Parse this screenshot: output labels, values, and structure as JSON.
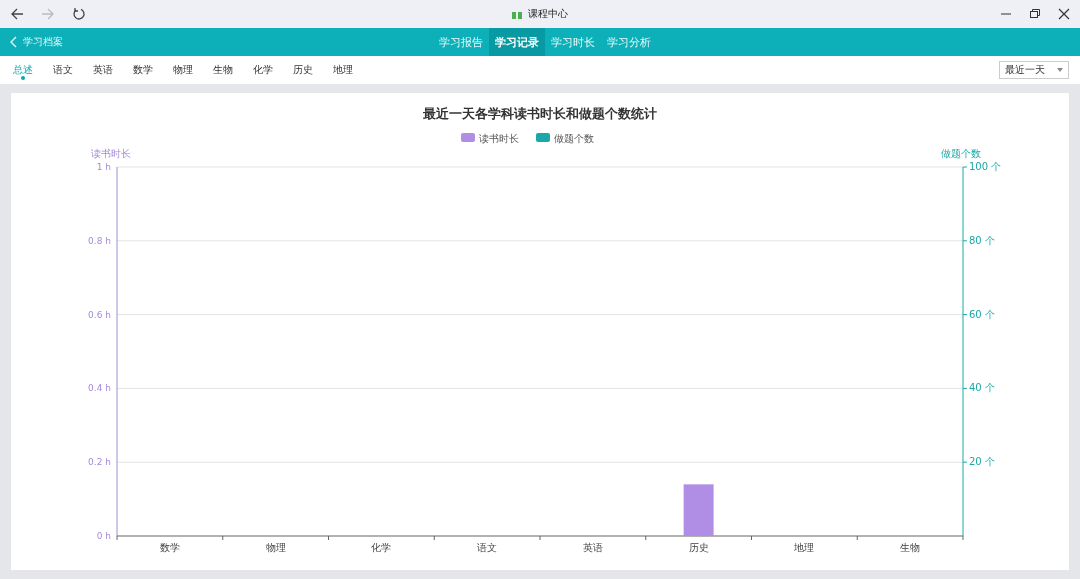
{
  "window": {
    "title": "课程中心"
  },
  "header": {
    "back_label": "学习档案",
    "tabs": [
      {
        "label": "学习报告",
        "selected": false
      },
      {
        "label": "学习记录",
        "selected": true
      },
      {
        "label": "学习时长",
        "selected": false
      },
      {
        "label": "学习分析",
        "selected": false
      }
    ]
  },
  "subjects": [
    {
      "label": "总述",
      "selected": true
    },
    {
      "label": "语文",
      "selected": false
    },
    {
      "label": "英语",
      "selected": false
    },
    {
      "label": "数学",
      "selected": false
    },
    {
      "label": "物理",
      "selected": false
    },
    {
      "label": "生物",
      "selected": false
    },
    {
      "label": "化学",
      "selected": false
    },
    {
      "label": "历史",
      "selected": false
    },
    {
      "label": "地理",
      "selected": false
    }
  ],
  "range_select": {
    "value": "最近一天"
  },
  "chart": {
    "chart_data": {
      "type": "bar",
      "title": "最近一天各学科读书时长和做题个数统计",
      "ylabel": "读书时长",
      "grid": true,
      "categories": [
        "数学",
        "物理",
        "化学",
        "语文",
        "英语",
        "历史",
        "地理",
        "生物"
      ],
      "series": [
        {
          "name": "读书时长",
          "color": "#b08ee6",
          "values": [
            0,
            0,
            0,
            0,
            0,
            0.14,
            0,
            0
          ]
        },
        {
          "name": "做题个数",
          "color": "#1aa8a8",
          "values": [
            0,
            0,
            0,
            0,
            0,
            0,
            0,
            0
          ]
        }
      ],
      "ylim": [
        0,
        1
      ],
      "yticks": [
        {
          "value": 0,
          "label": "0 h"
        },
        {
          "value": 0.2,
          "label": "0.2 h"
        },
        {
          "value": 0.4,
          "label": "0.4 h"
        },
        {
          "value": 0.6,
          "label": "0.6 h"
        },
        {
          "value": 0.8,
          "label": "0.8 h"
        },
        {
          "value": 1,
          "label": "1 h"
        }
      ]
    },
    "right_axis": {
      "title": "做题个数",
      "tick_labels": [
        "100 个",
        "80 个",
        "60 个",
        "40 个",
        "20 个"
      ]
    }
  }
}
